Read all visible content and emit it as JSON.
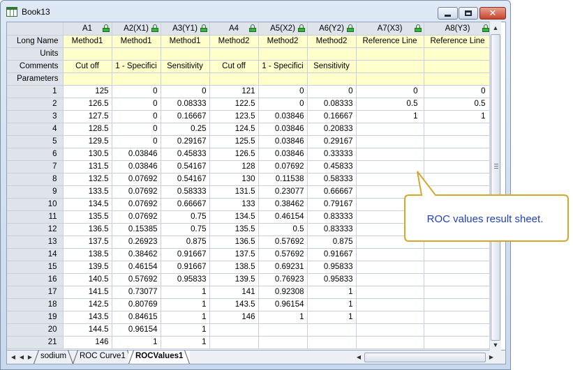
{
  "window": {
    "title": "Book13",
    "colors": {
      "metaRow": "#ffffcc",
      "header": "#dfe3ea",
      "lock": "#3cb043"
    }
  },
  "columns": [
    {
      "short": "A1",
      "designation": ""
    },
    {
      "short": "A2",
      "designation": "(X1)"
    },
    {
      "short": "A3",
      "designation": "(Y1)"
    },
    {
      "short": "A4",
      "designation": ""
    },
    {
      "short": "A5",
      "designation": "(X2)"
    },
    {
      "short": "A6",
      "designation": "(Y2)"
    },
    {
      "short": "A7",
      "designation": "(X3)"
    },
    {
      "short": "A8",
      "designation": "(Y3)"
    }
  ],
  "meta_rows": [
    {
      "label": "Long Name",
      "values": [
        "Method1",
        "Method1",
        "Method1",
        "Method2",
        "Method2",
        "Method2",
        "Reference Line",
        "Reference Line"
      ]
    },
    {
      "label": "Units",
      "values": [
        "",
        "",
        "",
        "",
        "",
        "",
        "",
        ""
      ]
    },
    {
      "label": "Comments",
      "values": [
        "Cut off",
        "1 - Specifici",
        "Sensitivity",
        "Cut off",
        "1 - Specifici",
        "Sensitivity",
        "",
        ""
      ]
    },
    {
      "label": "Parameters",
      "values": [
        "",
        "",
        "",
        "",
        "",
        "",
        "",
        ""
      ]
    }
  ],
  "rows": [
    {
      "n": "1",
      "values": [
        "125",
        "0",
        "0",
        "121",
        "0",
        "0",
        "0",
        "0"
      ]
    },
    {
      "n": "2",
      "values": [
        "126.5",
        "0",
        "0.08333",
        "122.5",
        "0",
        "0.08333",
        "0.5",
        "0.5"
      ]
    },
    {
      "n": "3",
      "values": [
        "127.5",
        "0",
        "0.16667",
        "123.5",
        "0.03846",
        "0.16667",
        "1",
        "1"
      ]
    },
    {
      "n": "4",
      "values": [
        "128.5",
        "0",
        "0.25",
        "124.5",
        "0.03846",
        "0.20833",
        "",
        ""
      ]
    },
    {
      "n": "5",
      "values": [
        "129.5",
        "0",
        "0.29167",
        "125.5",
        "0.03846",
        "0.29167",
        "",
        ""
      ]
    },
    {
      "n": "6",
      "values": [
        "130.5",
        "0.03846",
        "0.45833",
        "126.5",
        "0.03846",
        "0.33333",
        "",
        ""
      ]
    },
    {
      "n": "7",
      "values": [
        "131.5",
        "0.03846",
        "0.54167",
        "128",
        "0.07692",
        "0.45833",
        "",
        ""
      ]
    },
    {
      "n": "8",
      "values": [
        "132.5",
        "0.07692",
        "0.54167",
        "130",
        "0.11538",
        "0.58333",
        "",
        ""
      ]
    },
    {
      "n": "9",
      "values": [
        "133.5",
        "0.07692",
        "0.58333",
        "131.5",
        "0.23077",
        "0.66667",
        "",
        ""
      ]
    },
    {
      "n": "10",
      "values": [
        "134.5",
        "0.07692",
        "0.66667",
        "133",
        "0.38462",
        "0.79167",
        "",
        ""
      ]
    },
    {
      "n": "11",
      "values": [
        "135.5",
        "0.07692",
        "0.75",
        "134.5",
        "0.46154",
        "0.83333",
        "",
        ""
      ]
    },
    {
      "n": "12",
      "values": [
        "136.5",
        "0.15385",
        "0.75",
        "135.5",
        "0.5",
        "0.83333",
        "",
        ""
      ]
    },
    {
      "n": "13",
      "values": [
        "137.5",
        "0.26923",
        "0.875",
        "136.5",
        "0.57692",
        "0.875",
        "",
        ""
      ]
    },
    {
      "n": "14",
      "values": [
        "138.5",
        "0.38462",
        "0.91667",
        "137.5",
        "0.57692",
        "0.91667",
        "",
        ""
      ]
    },
    {
      "n": "15",
      "values": [
        "139.5",
        "0.46154",
        "0.91667",
        "138.5",
        "0.69231",
        "0.95833",
        "",
        ""
      ]
    },
    {
      "n": "16",
      "values": [
        "140.5",
        "0.57692",
        "0.95833",
        "139.5",
        "0.76923",
        "0.95833",
        "",
        ""
      ]
    },
    {
      "n": "17",
      "values": [
        "141.5",
        "0.73077",
        "1",
        "141",
        "0.92308",
        "1",
        "",
        ""
      ]
    },
    {
      "n": "18",
      "values": [
        "142.5",
        "0.80769",
        "1",
        "143.5",
        "0.96154",
        "1",
        "",
        ""
      ]
    },
    {
      "n": "19",
      "values": [
        "143.5",
        "0.84615",
        "1",
        "146",
        "1",
        "1",
        "",
        ""
      ]
    },
    {
      "n": "20",
      "values": [
        "144.5",
        "0.96154",
        "1",
        "",
        "",
        "",
        "",
        ""
      ]
    },
    {
      "n": "21",
      "values": [
        "146",
        "1",
        "1",
        "",
        "",
        "",
        "",
        ""
      ]
    }
  ],
  "tabs": [
    "sodium",
    "ROC Curve1",
    "ROCValues1"
  ],
  "active_tab": "ROCValues1",
  "callout": {
    "text": "ROC values result sheet."
  },
  "icons": [
    "worksheet-icon",
    "lock-icon",
    "minimize-icon",
    "maximize-icon",
    "close-icon",
    "scroll-up-icon",
    "scroll-down-icon",
    "scroll-left-icon",
    "scroll-right-icon"
  ]
}
